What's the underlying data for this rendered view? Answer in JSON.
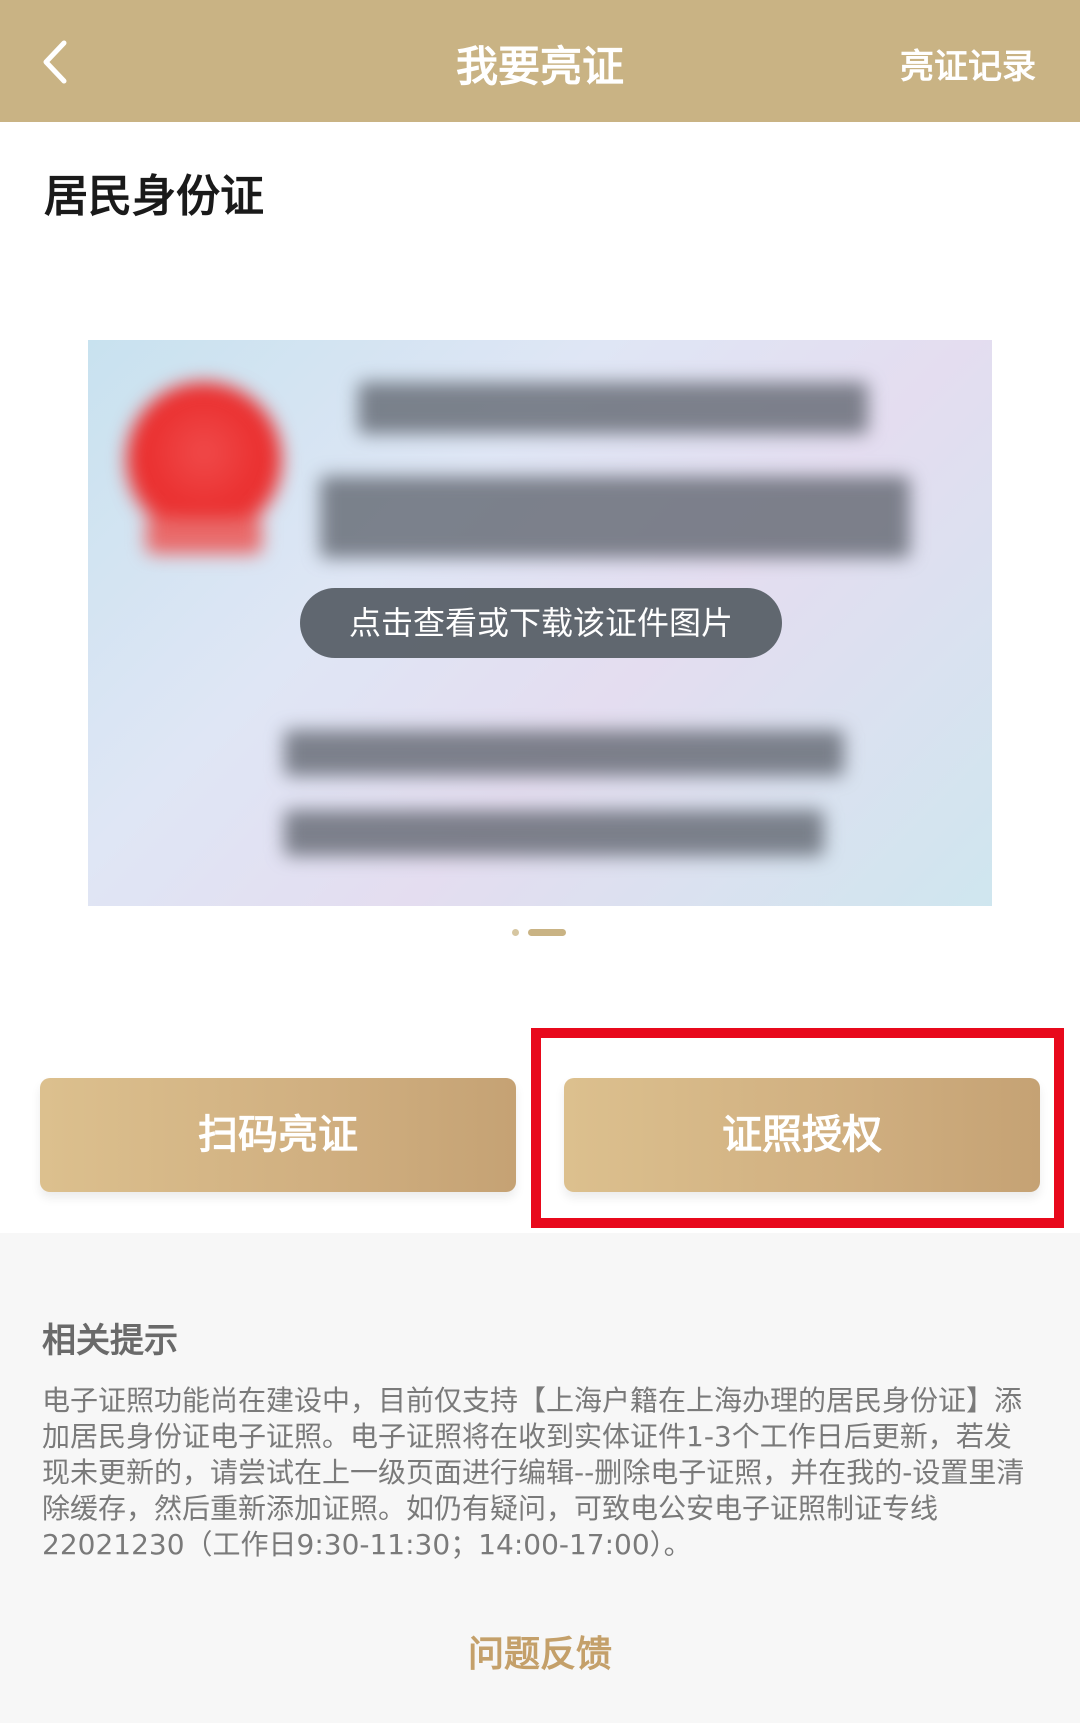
{
  "header": {
    "title": "我要亮证",
    "record_link": "亮证记录",
    "back_icon": "chevron-left-icon"
  },
  "document": {
    "title": "居民身份证",
    "view_hint": "点击查看或下载该证件图片",
    "carousel": {
      "total": 2,
      "active": 2
    }
  },
  "actions": {
    "scan_label": "扫码亮证",
    "auth_label": "证照授权"
  },
  "tips": {
    "heading": "相关提示",
    "body": "电子证照功能尚在建设中，目前仅支持【上海户籍在上海办理的居民身份证】添加居民身份证电子证照。电子证照将在收到实体证件1-3个工作日后更新，若发现未更新的，请尝试在上一级页面进行编辑--删除电子证照，并在我的-设置里清除缓存，然后重新添加证照。如仍有疑问，可致电公安电子证照制证专线22021230（工作日9:30-11:30；14:00-17:00）。",
    "feedback_link": "问题反馈"
  },
  "colors": {
    "header_bg": "#c9b384",
    "button_gold": "#d0af80",
    "highlight_red": "#e8091c",
    "link_gold": "#c4a06a"
  }
}
